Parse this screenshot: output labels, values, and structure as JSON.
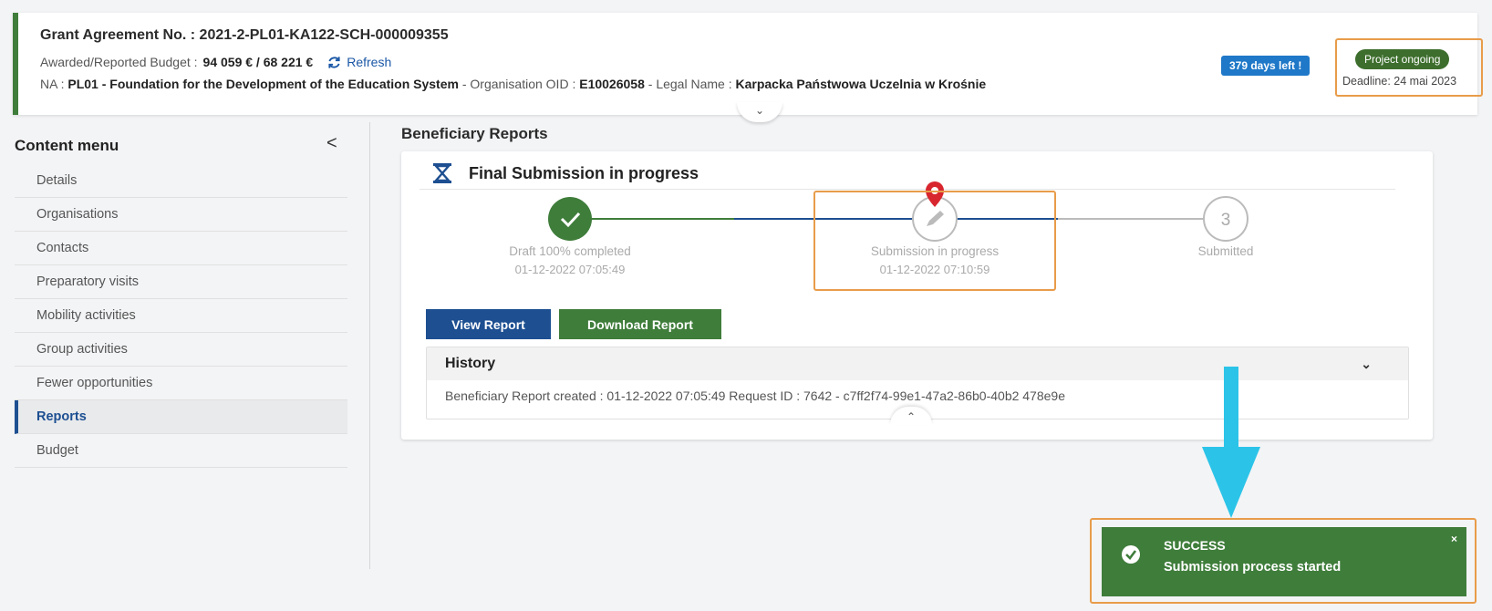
{
  "header": {
    "grant_label": "Grant Agreement No. : 2021-2-PL01-KA122-SCH-000009355",
    "budget_label": "Awarded/Reported Budget :",
    "budget_value": "94 059 € / 68 221 €",
    "refresh_label": "Refresh",
    "na_prefix": "NA :",
    "na_value": "PL01 - Foundation for the Development of the Education System",
    "oid_label": " - Organisation OID :",
    "oid_value": "E10026058",
    "legal_label": " - Legal Name :",
    "legal_value": "Karpacka Państwowa Uczelnia w Krośnie",
    "days_left": "379 days left !",
    "status": "Project ongoing",
    "deadline": "Deadline: 24 mai 2023"
  },
  "sidebar": {
    "title": "Content menu",
    "collapse_icon": "<",
    "items": [
      {
        "label": "Details"
      },
      {
        "label": "Organisations"
      },
      {
        "label": "Contacts"
      },
      {
        "label": "Preparatory visits"
      },
      {
        "label": "Mobility activities"
      },
      {
        "label": "Group activities"
      },
      {
        "label": "Fewer opportunities"
      },
      {
        "label": "Reports"
      },
      {
        "label": "Budget"
      }
    ]
  },
  "main": {
    "title": "Beneficiary Reports",
    "card_title": "Final Submission in progress",
    "steps": [
      {
        "label": "Draft 100% completed",
        "date": "01-12-2022 07:05:49"
      },
      {
        "label": "Submission in progress",
        "date": "01-12-2022 07:10:59"
      },
      {
        "label": "Submitted",
        "number": "3"
      }
    ],
    "view_button": "View Report",
    "download_button": "Download Report",
    "history_title": "History",
    "history_entry": "Beneficiary Report created : 01-12-2022 07:05:49 Request ID : 7642 - c7ff2f74-99e1-47a2-86b0-40b2  478e9e"
  },
  "toast": {
    "title": "SUCCESS",
    "message": "Submission process started",
    "close": "×"
  },
  "colors": {
    "green": "#3f7d3b",
    "blue": "#1d4f91",
    "accent_blue": "#1f78c8",
    "highlight_orange": "#e89c4a",
    "arrow_cyan": "#2bc4e8",
    "pin_red": "#d8262f"
  }
}
